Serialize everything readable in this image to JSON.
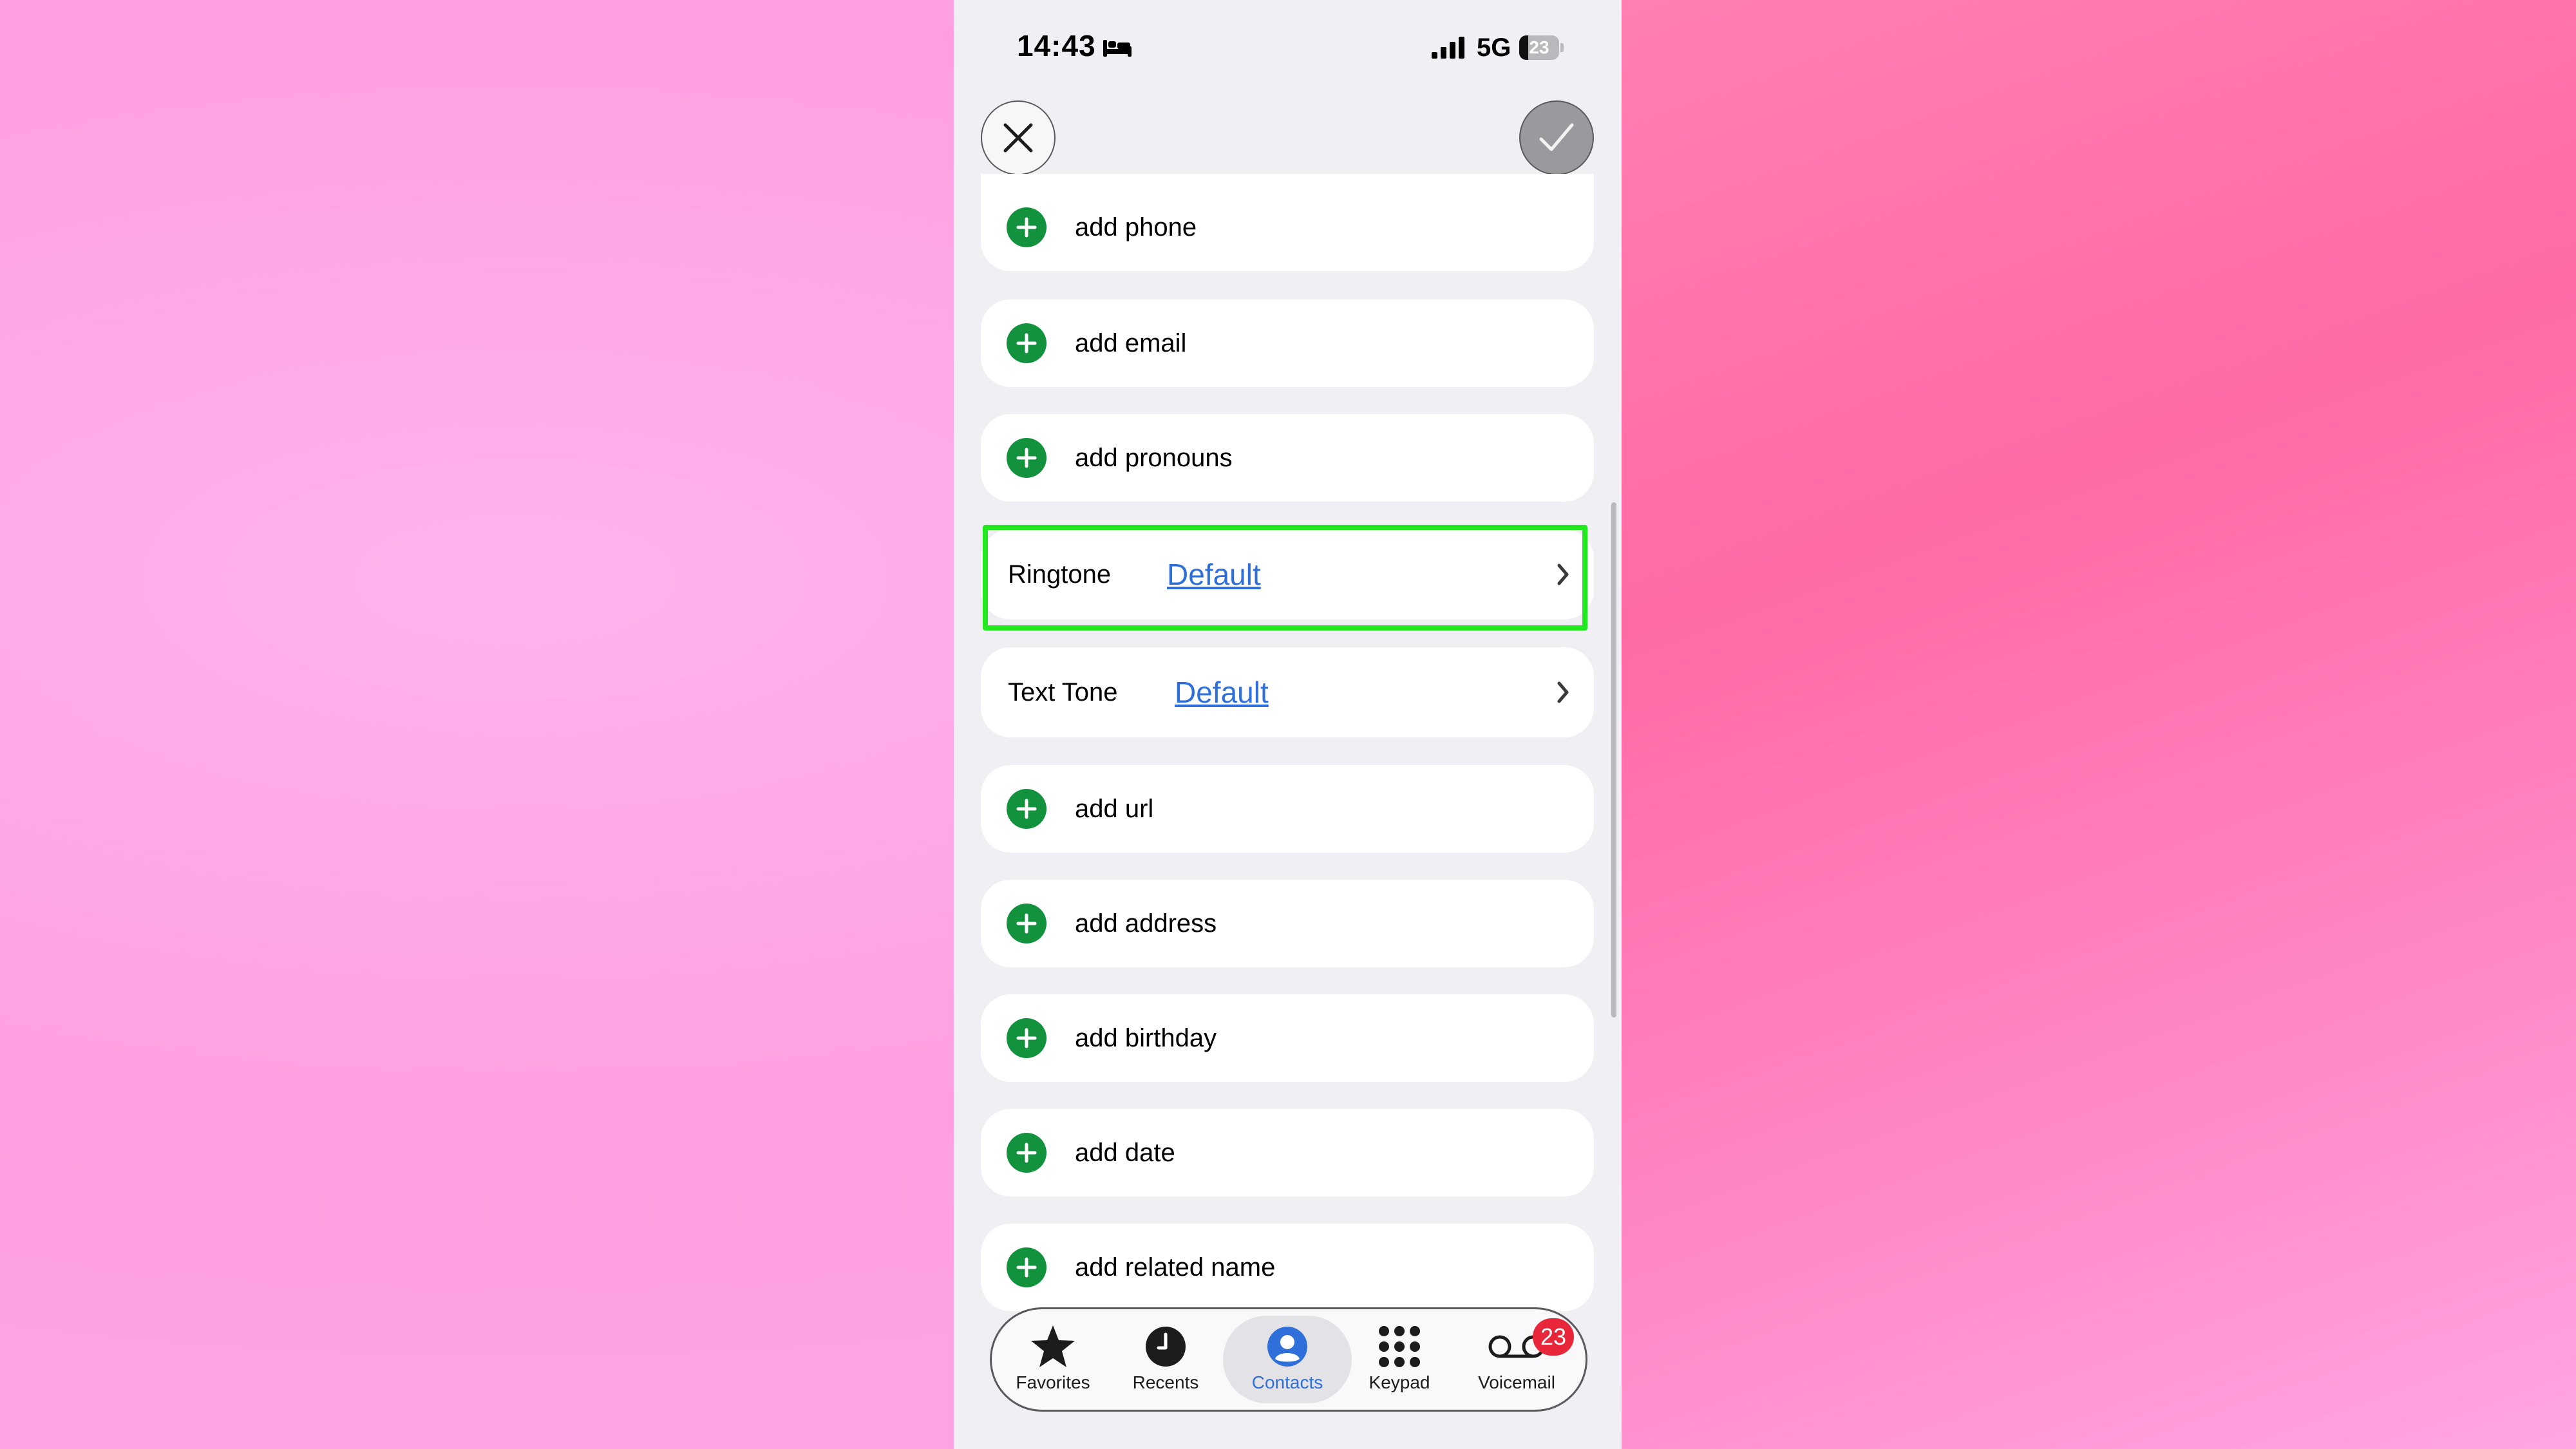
{
  "status_bar": {
    "time": "14:43",
    "sleep_icon": "bed-icon",
    "network": "5G",
    "battery_level": "23",
    "battery_fraction": 0.23
  },
  "top_bar": {
    "close_icon": "close-icon",
    "done_icon": "checkmark-icon"
  },
  "rows": [
    {
      "label": "add phone"
    },
    {
      "label": "add email"
    },
    {
      "label": "add pronouns"
    }
  ],
  "ringtone": {
    "label": "Ringtone",
    "value": "Default"
  },
  "text_tone": {
    "label": "Text Tone",
    "value": "Default"
  },
  "rows2": [
    {
      "label": "add url"
    },
    {
      "label": "add address"
    },
    {
      "label": "add birthday"
    },
    {
      "label": "add date"
    },
    {
      "label": "add related name"
    }
  ],
  "tabs": [
    {
      "label": "Favorites",
      "icon": "star-icon"
    },
    {
      "label": "Recents",
      "icon": "clock-icon"
    },
    {
      "label": "Contacts",
      "icon": "person-icon",
      "active": true
    },
    {
      "label": "Keypad",
      "icon": "keypad-icon"
    },
    {
      "label": "Voicemail",
      "icon": "voicemail-icon",
      "badge": "23"
    }
  ],
  "colors": {
    "accent": "#2f6fd9",
    "add_green": "#12923c",
    "highlight": "#22e81e",
    "badge": "#e8283a"
  }
}
